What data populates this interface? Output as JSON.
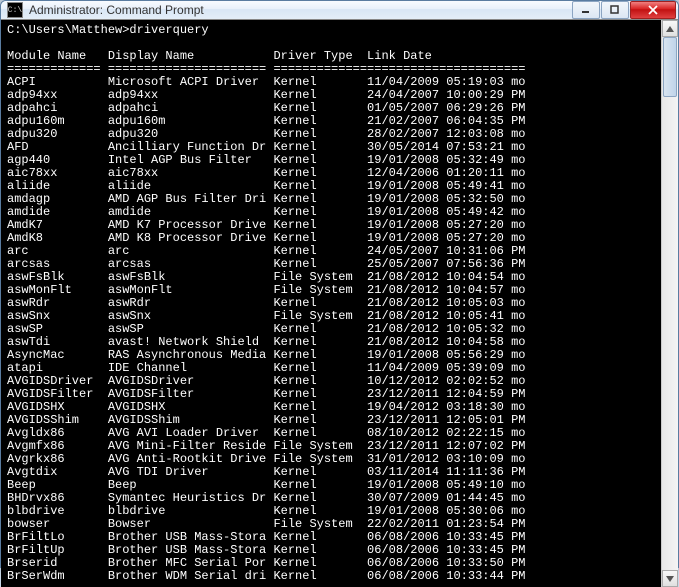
{
  "window": {
    "title": "Administrator: Command Prompt",
    "icon_text": "C:\\"
  },
  "prompt": {
    "path": "C:\\Users\\Matthew>",
    "command": "driverquery"
  },
  "headers": {
    "module": "Module Name",
    "display": "Display Name",
    "type": "Driver Type",
    "link": "Link Date"
  },
  "ruler": {
    "c1": "=============",
    "c2": "======================",
    "c3": "=============",
    "c4": "======================"
  },
  "rows": [
    {
      "m": "ACPI",
      "d": "Microsoft ACPI Driver",
      "t": "Kernel",
      "l": "11/04/2009 05:19:03 mo"
    },
    {
      "m": "adp94xx",
      "d": "adp94xx",
      "t": "Kernel",
      "l": "24/04/2007 10:00:29 PM"
    },
    {
      "m": "adpahci",
      "d": "adpahci",
      "t": "Kernel",
      "l": "01/05/2007 06:29:26 PM"
    },
    {
      "m": "adpu160m",
      "d": "adpu160m",
      "t": "Kernel",
      "l": "21/02/2007 06:04:35 PM"
    },
    {
      "m": "adpu320",
      "d": "adpu320",
      "t": "Kernel",
      "l": "28/02/2007 12:03:08 mo"
    },
    {
      "m": "AFD",
      "d": "Ancilliary Function Dr",
      "t": "Kernel",
      "l": "30/05/2014 07:53:21 mo"
    },
    {
      "m": "agp440",
      "d": "Intel AGP Bus Filter",
      "t": "Kernel",
      "l": "19/01/2008 05:32:49 mo"
    },
    {
      "m": "aic78xx",
      "d": "aic78xx",
      "t": "Kernel",
      "l": "12/04/2006 01:20:11 mo"
    },
    {
      "m": "aliide",
      "d": "aliide",
      "t": "Kernel",
      "l": "19/01/2008 05:49:41 mo"
    },
    {
      "m": "amdagp",
      "d": "AMD AGP Bus Filter Dri",
      "t": "Kernel",
      "l": "19/01/2008 05:32:50 mo"
    },
    {
      "m": "amdide",
      "d": "amdide",
      "t": "Kernel",
      "l": "19/01/2008 05:49:42 mo"
    },
    {
      "m": "AmdK7",
      "d": "AMD K7 Processor Drive",
      "t": "Kernel",
      "l": "19/01/2008 05:27:20 mo"
    },
    {
      "m": "AmdK8",
      "d": "AMD K8 Processor Drive",
      "t": "Kernel",
      "l": "19/01/2008 05:27:20 mo"
    },
    {
      "m": "arc",
      "d": "arc",
      "t": "Kernel",
      "l": "24/05/2007 10:31:06 PM"
    },
    {
      "m": "arcsas",
      "d": "arcsas",
      "t": "Kernel",
      "l": "25/05/2007 07:56:36 PM"
    },
    {
      "m": "aswFsBlk",
      "d": "aswFsBlk",
      "t": "File System",
      "l": "21/08/2012 10:04:54 mo"
    },
    {
      "m": "aswMonFlt",
      "d": "aswMonFlt",
      "t": "File System",
      "l": "21/08/2012 10:04:57 mo"
    },
    {
      "m": "aswRdr",
      "d": "aswRdr",
      "t": "Kernel",
      "l": "21/08/2012 10:05:03 mo"
    },
    {
      "m": "aswSnx",
      "d": "aswSnx",
      "t": "File System",
      "l": "21/08/2012 10:05:41 mo"
    },
    {
      "m": "aswSP",
      "d": "aswSP",
      "t": "Kernel",
      "l": "21/08/2012 10:05:32 mo"
    },
    {
      "m": "aswTdi",
      "d": "avast! Network Shield",
      "t": "Kernel",
      "l": "21/08/2012 10:04:58 mo"
    },
    {
      "m": "AsyncMac",
      "d": "RAS Asynchronous Media",
      "t": "Kernel",
      "l": "19/01/2008 05:56:29 mo"
    },
    {
      "m": "atapi",
      "d": "IDE Channel",
      "t": "Kernel",
      "l": "11/04/2009 05:39:09 mo"
    },
    {
      "m": "AVGIDSDriver",
      "d": "AVGIDSDriver",
      "t": "Kernel",
      "l": "10/12/2012 02:02:52 mo"
    },
    {
      "m": "AVGIDSFilter",
      "d": "AVGIDSFilter",
      "t": "Kernel",
      "l": "23/12/2011 12:04:59 PM"
    },
    {
      "m": "AVGIDSHX",
      "d": "AVGIDSHX",
      "t": "Kernel",
      "l": "19/04/2012 03:18:30 mo"
    },
    {
      "m": "AVGIDSShim",
      "d": "AVGIDSShim",
      "t": "Kernel",
      "l": "23/12/2011 12:05:01 PM"
    },
    {
      "m": "Avgldx86",
      "d": "AVG AVI Loader Driver",
      "t": "Kernel",
      "l": "08/10/2012 02:22:15 mo"
    },
    {
      "m": "Avgmfx86",
      "d": "AVG Mini-Filter Reside",
      "t": "File System",
      "l": "23/12/2011 12:07:02 PM"
    },
    {
      "m": "Avgrkx86",
      "d": "AVG Anti-Rootkit Drive",
      "t": "File System",
      "l": "31/01/2012 03:10:09 mo"
    },
    {
      "m": "Avgtdix",
      "d": "AVG TDI Driver",
      "t": "Kernel",
      "l": "03/11/2014 11:11:36 PM"
    },
    {
      "m": "Beep",
      "d": "Beep",
      "t": "Kernel",
      "l": "19/01/2008 05:49:10 mo"
    },
    {
      "m": "BHDrvx86",
      "d": "Symantec Heuristics Dr",
      "t": "Kernel",
      "l": "30/07/2009 01:44:45 mo"
    },
    {
      "m": "blbdrive",
      "d": "blbdrive",
      "t": "Kernel",
      "l": "19/01/2008 05:30:06 mo"
    },
    {
      "m": "bowser",
      "d": "Bowser",
      "t": "File System",
      "l": "22/02/2011 01:23:54 PM"
    },
    {
      "m": "BrFiltLo",
      "d": "Brother USB Mass-Stora",
      "t": "Kernel",
      "l": "06/08/2006 10:33:45 PM"
    },
    {
      "m": "BrFiltUp",
      "d": "Brother USB Mass-Stora",
      "t": "Kernel",
      "l": "06/08/2006 10:33:45 PM"
    },
    {
      "m": "Brserid",
      "d": "Brother MFC Serial Por",
      "t": "Kernel",
      "l": "06/08/2006 10:33:50 PM"
    },
    {
      "m": "BrSerWdm",
      "d": "Brother WDM Serial dri",
      "t": "Kernel",
      "l": "06/08/2006 10:33:44 PM"
    }
  ],
  "col_widths": {
    "c1": 14,
    "c2": 23,
    "c3": 13,
    "c4": 22
  }
}
